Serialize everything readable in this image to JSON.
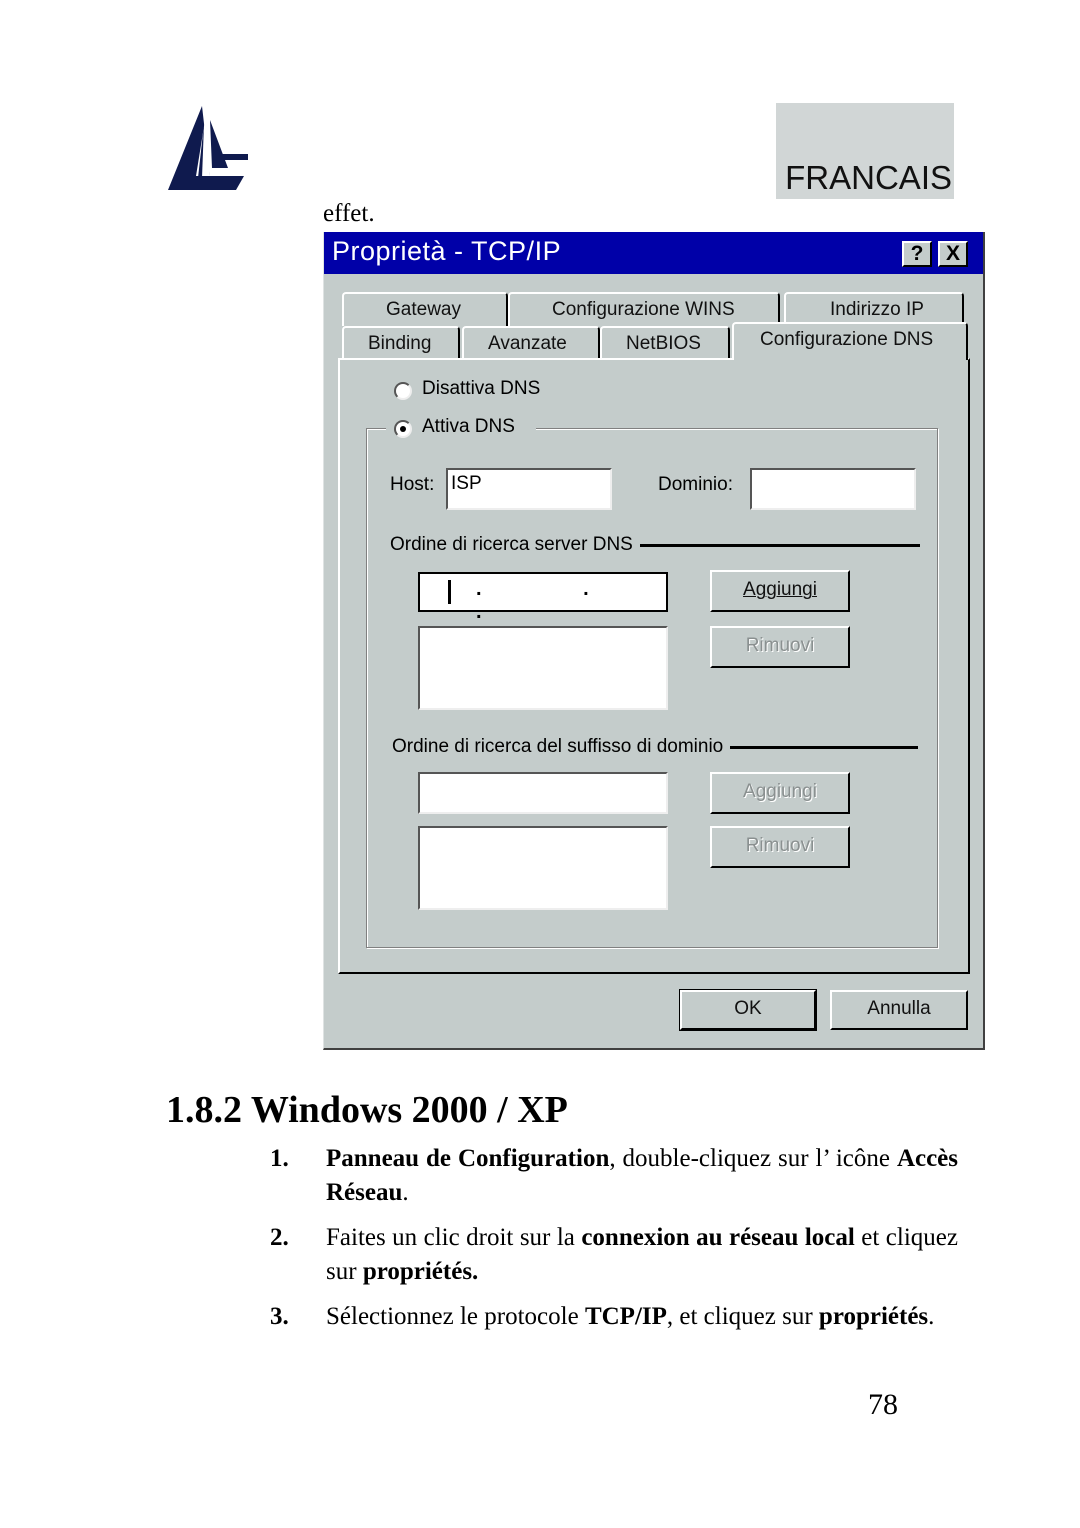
{
  "header": {
    "language_label": "FRANCAIS",
    "logo_icon": "atlantis-sail-logo"
  },
  "lead_text": "effet.",
  "dialog": {
    "title": "Proprietà - TCP/IP",
    "help_button": "?",
    "close_button": "X",
    "tabs_row1": [
      "Gateway",
      "Configurazione WINS",
      "Indirizzo IP"
    ],
    "tabs_row2": [
      "Binding",
      "Avanzate",
      "NetBIOS",
      "Configurazione DNS"
    ],
    "active_tab": "Configurazione DNS",
    "radio_disable": "Disattiva DNS",
    "radio_enable": "Attiva DNS",
    "selected_radio": "Attiva DNS",
    "host_label": "Host:",
    "host_value": "ISP",
    "domain_label": "Dominio:",
    "domain_value": "",
    "dns_search_label": "Ordine di ricerca server DNS",
    "dns_ip_value": ". . .",
    "dns_add_button": "Aggiungi",
    "dns_remove_button": "Rimuovi",
    "suffix_search_label": "Ordine di ricerca del suffisso di dominio",
    "suffix_add_button": "Aggiungi",
    "suffix_remove_button": "Rimuovi",
    "ok_button": "OK",
    "cancel_button": "Annulla"
  },
  "section": {
    "heading": "1.8.2 Windows 2000 / XP",
    "steps": [
      {
        "num": "1.",
        "bold1": "Panneau de Configuration",
        "text1": ", double-cliquez sur l’ icône ",
        "bold2": "Accès Réseau",
        "text2": "."
      },
      {
        "num": "2.",
        "text1": "Faites un clic droit sur la ",
        "bold1": "connexion au réseau local",
        "text2": " et cliquez sur ",
        "bold2": "propriétés."
      },
      {
        "num": "3.",
        "text1": "Sélectionnez le protocole ",
        "bold1": "TCP/IP",
        "text2": ", et cliquez sur ",
        "bold2": "propriétés",
        "text3": "."
      }
    ]
  },
  "page_number": "78"
}
